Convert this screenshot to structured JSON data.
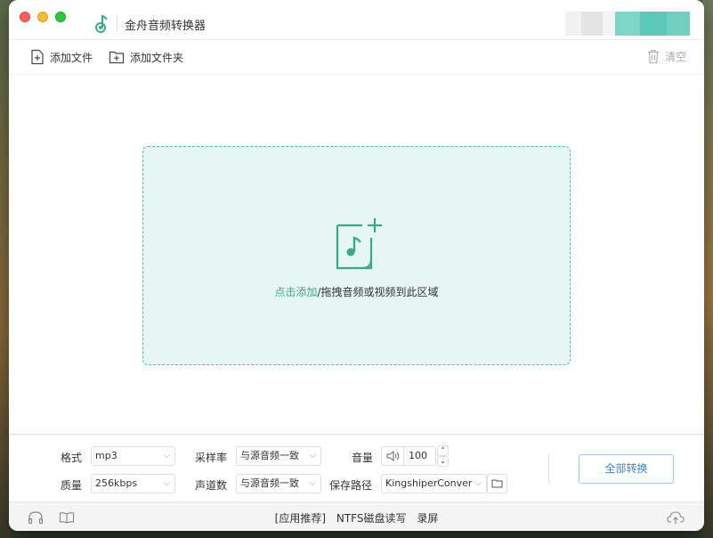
{
  "window": {
    "title": "金舟音频转换器",
    "accent_color": "#3aa98a"
  },
  "toolbar": {
    "add_file_label": "添加文件",
    "add_folder_label": "添加文件夹",
    "clear_label": "清空"
  },
  "dropzone": {
    "link_text": "点击添加",
    "rest_text": "/拖拽音频或视频到此区域"
  },
  "settings": {
    "format_label": "格式",
    "format_value": "mp3",
    "quality_label": "质量",
    "quality_value": "256kbps",
    "sample_rate_label": "采样率",
    "sample_rate_value": "与源音频一致",
    "channels_label": "声道数",
    "channels_value": "与源音频一致",
    "volume_label": "音量",
    "volume_value": "100",
    "save_path_label": "保存路径",
    "save_path_value": "KingshiperConver",
    "convert_all_label": "全部转换"
  },
  "footer": {
    "app_recommend": "[应用推荐]",
    "ntfs": "NTFS磁盘读写",
    "record": "录屏"
  }
}
